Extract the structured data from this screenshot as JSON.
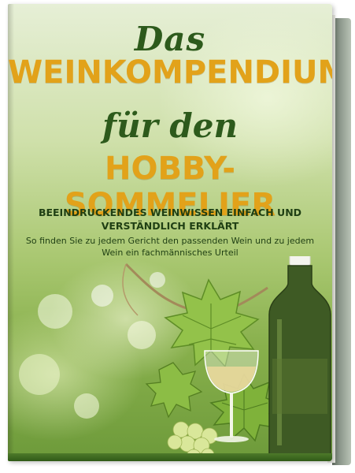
{
  "cover": {
    "title_line1": "Das",
    "title_line2": "WEINKOMPENDIUM",
    "title_line3": "für den",
    "title_line4": "HOBBY-SOMMELIER",
    "subtitle_bold": "BEEINDRUCKENDES WEINWISSEN EINFACH UND VERSTÄNDLICH ERKLÄRT",
    "subtitle": "So finden Sie zu jedem Gericht den passenden Wein und zu jedem Wein ein fachmännisches Urteil"
  },
  "colors": {
    "title_dark": "#2d5a1c",
    "title_gold": "#e2a21a",
    "background_green": "#aac872"
  },
  "illustration": {
    "icons": [
      "wine-bottle-icon",
      "wine-glass-icon",
      "grape-leaf-icon",
      "grape-cluster-icon"
    ]
  }
}
